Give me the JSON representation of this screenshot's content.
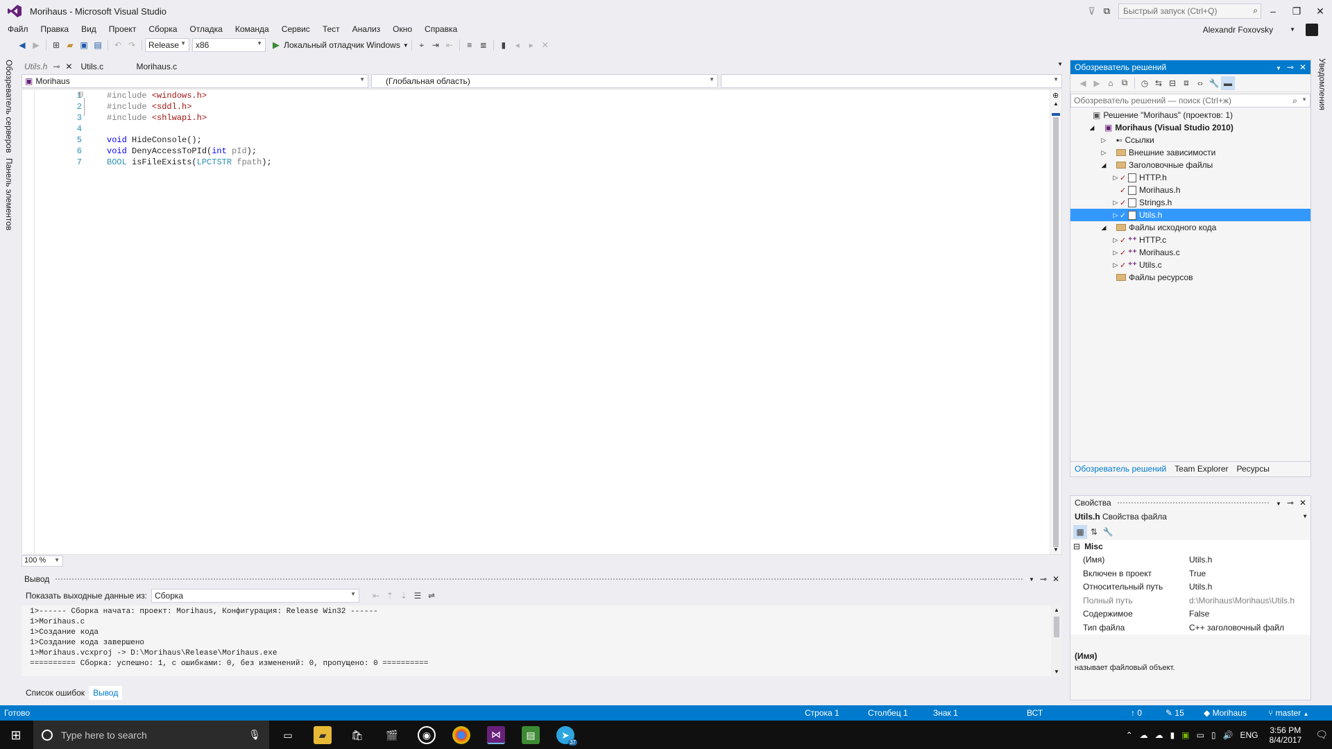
{
  "window": {
    "title": "Morihaus - Microsoft Visual Studio",
    "quick_launch": "Быстрый запуск (Ctrl+Q)",
    "user": "Alexandr Foxovsky"
  },
  "menu": [
    "Файл",
    "Правка",
    "Вид",
    "Проект",
    "Сборка",
    "Отладка",
    "Команда",
    "Сервис",
    "Тест",
    "Анализ",
    "Окно",
    "Справка"
  ],
  "toolbar": {
    "config": "Release",
    "platform": "x86",
    "debugger": "Локальный отладчик Windows"
  },
  "left_tabs": {
    "server_explorer": "Обозреватель серверов",
    "toolbox": "Панель элементов"
  },
  "doc_tabs": [
    {
      "label": "Utils.h",
      "active": true
    },
    {
      "label": "Utils.c",
      "active": false
    },
    {
      "label": "Morihaus.c",
      "active": false
    }
  ],
  "navbar": {
    "project": "Morihaus",
    "scope": "(Глобальная область)",
    "member": ""
  },
  "editor": {
    "line_numbers": [
      "1",
      "2",
      "3",
      "4",
      "5",
      "6",
      "7"
    ],
    "zoom": "100 %"
  },
  "output": {
    "title": "Вывод",
    "show_from_label": "Показать выходные данные из:",
    "show_from_value": "Сборка",
    "lines": [
      "1>------ Сборка начата: проект: Morihaus, Конфигурация: Release Win32 ------",
      "1>Morihaus.c",
      "1>Создание кода",
      "1>Создание кода завершено",
      "1>Morihaus.vcxproj -> D:\\Morihaus\\Release\\Morihaus.exe",
      "========== Сборка: успешно: 1, с ошибками: 0, без изменений: 0, пропущено: 0 =========="
    ]
  },
  "bottom_tabs": [
    "Список ошибок",
    "Вывод"
  ],
  "solution_explorer": {
    "title": "Обозреватель решений",
    "search": "Обозреватель решений — поиск (Ctrl+ж)",
    "items": [
      {
        "label": "Решение \"Morihaus\" (проектов: 1)"
      },
      {
        "label": "Morihaus (Visual Studio 2010)"
      },
      {
        "label": "Ссылки"
      },
      {
        "label": "Внешние зависимости"
      },
      {
        "label": "Заголовочные файлы"
      },
      {
        "label": "HTTP.h"
      },
      {
        "label": "Morihaus.h"
      },
      {
        "label": "Strings.h"
      },
      {
        "label": "Utils.h"
      },
      {
        "label": "Файлы исходного кода"
      },
      {
        "label": "HTTP.c"
      },
      {
        "label": "Morihaus.c"
      },
      {
        "label": "Utils.c"
      },
      {
        "label": "Файлы ресурсов"
      }
    ],
    "tabs": [
      "Обозреватель решений",
      "Team Explorer",
      "Ресурсы"
    ]
  },
  "properties": {
    "title": "Свойства",
    "object": "Utils.h",
    "object_type": "Свойства файла",
    "category": "Misc",
    "rows": [
      {
        "k": "(Имя)",
        "v": "Utils.h"
      },
      {
        "k": "Включен в проект",
        "v": "True"
      },
      {
        "k": "Относительный путь",
        "v": "Utils.h"
      },
      {
        "k": "Полный путь",
        "v": "d:\\Morihaus\\Morihaus\\Utils.h"
      },
      {
        "k": "Содержимое",
        "v": "False"
      },
      {
        "k": "Тип файла",
        "v": "C++ заголовочный файл"
      }
    ],
    "desc_title": "(Имя)",
    "desc_text": "называет файловый объект."
  },
  "right_strip": "Уведомления",
  "status": {
    "ready": "Готово",
    "line": "Строка 1",
    "col": "Столбец 1",
    "ch": "Знак 1",
    "ins": "ВСТ",
    "up": "0",
    "edits": "15",
    "repo": "Morihaus",
    "branch": "master"
  },
  "taskbar": {
    "search": "Type here to search",
    "lang": "ENG",
    "time": "3:56 PM",
    "date": "8/4/2017",
    "telegram_badge": "37"
  },
  "colors": {
    "accent": "#007acc",
    "selection": "#3399ff",
    "keyword": "#0000ff",
    "string": "#a31515",
    "type": "#2b91af"
  }
}
